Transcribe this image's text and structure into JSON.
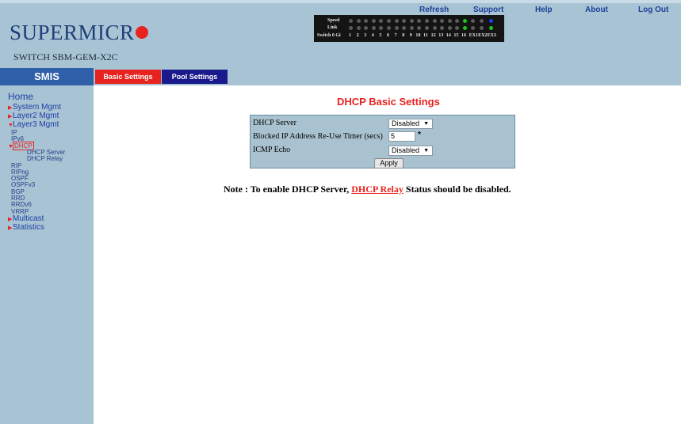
{
  "top_links": [
    "Refresh",
    "Support",
    "Help",
    "About",
    "Log Out"
  ],
  "brand": {
    "logo_text": "SUPERMICR",
    "switch_name": "SWITCH SBM-GEM-X2C"
  },
  "ports": {
    "speed_label": "Speed",
    "link_label": "Link",
    "switch_label": "Switch 0 Gi",
    "numbers": [
      "1",
      "2",
      "3",
      "4",
      "5",
      "6",
      "7",
      "8",
      "9",
      "10",
      "11",
      "12",
      "13",
      "14",
      "15",
      "16",
      "EX1",
      "EX2",
      "EX3"
    ],
    "speed_leds": [
      "off",
      "off",
      "off",
      "off",
      "off",
      "off",
      "off",
      "off",
      "off",
      "off",
      "off",
      "off",
      "off",
      "off",
      "off",
      "green",
      "off",
      "off",
      "blue"
    ],
    "link_leds": [
      "off",
      "off",
      "off",
      "off",
      "off",
      "off",
      "off",
      "off",
      "off",
      "off",
      "off",
      "off",
      "off",
      "off",
      "off",
      "green",
      "off",
      "off",
      "green"
    ],
    "colors": {
      "off": "#5a5a5a",
      "green": "#1ec41e",
      "blue": "#1a3fe8"
    }
  },
  "smis_label": "SMIS",
  "tabs": [
    {
      "label": "Basic Settings",
      "color": "#e8231f"
    },
    {
      "label": "Pool Settings",
      "color": "#1a1a8c"
    }
  ],
  "sidebar": {
    "home": "Home",
    "items": [
      {
        "label": "System Mgmt",
        "level": 1,
        "arrow": "right"
      },
      {
        "label": "Layer2 Mgmt",
        "level": 1,
        "arrow": "right"
      },
      {
        "label": "Layer3 Mgmt",
        "level": 1,
        "arrow": "down"
      },
      {
        "label": "IP",
        "level": 2
      },
      {
        "label": "IPv6",
        "level": 2
      },
      {
        "label": "DHCP",
        "level": 2,
        "arrow": "down",
        "selected": true
      },
      {
        "label": "DHCP Server",
        "level": 3
      },
      {
        "label": "DHCP Relay",
        "level": 3
      },
      {
        "label": "RIP",
        "level": 2
      },
      {
        "label": "RIPng",
        "level": 2
      },
      {
        "label": "OSPF",
        "level": 2
      },
      {
        "label": "OSPFv3",
        "level": 2
      },
      {
        "label": "BGP",
        "level": 2
      },
      {
        "label": "RRD",
        "level": 2
      },
      {
        "label": "RRDv6",
        "level": 2
      },
      {
        "label": "VRRP",
        "level": 2
      },
      {
        "label": "Multicast",
        "level": 1,
        "arrow": "right"
      },
      {
        "label": "Statistics",
        "level": 1,
        "arrow": "right"
      }
    ]
  },
  "main": {
    "title": "DHCP Basic Settings",
    "dhcp_server_label": "DHCP Server",
    "dhcp_server_value": "Disabled",
    "timer_label": "Blocked IP Address Re-Use Timer (secs)",
    "timer_value": "5",
    "required_mark": "*",
    "icmp_label": "ICMP Echo",
    "icmp_value": "Disabled",
    "apply_label": "Apply",
    "note_prefix": "Note : To enable DHCP Server,",
    "note_link": "DHCP Relay",
    "note_suffix": "Status should be disabled."
  },
  "colors": {
    "accent_red": "#e8231f",
    "header_bg": "#a8c3d3",
    "nav_blue": "#1d3fa8"
  }
}
